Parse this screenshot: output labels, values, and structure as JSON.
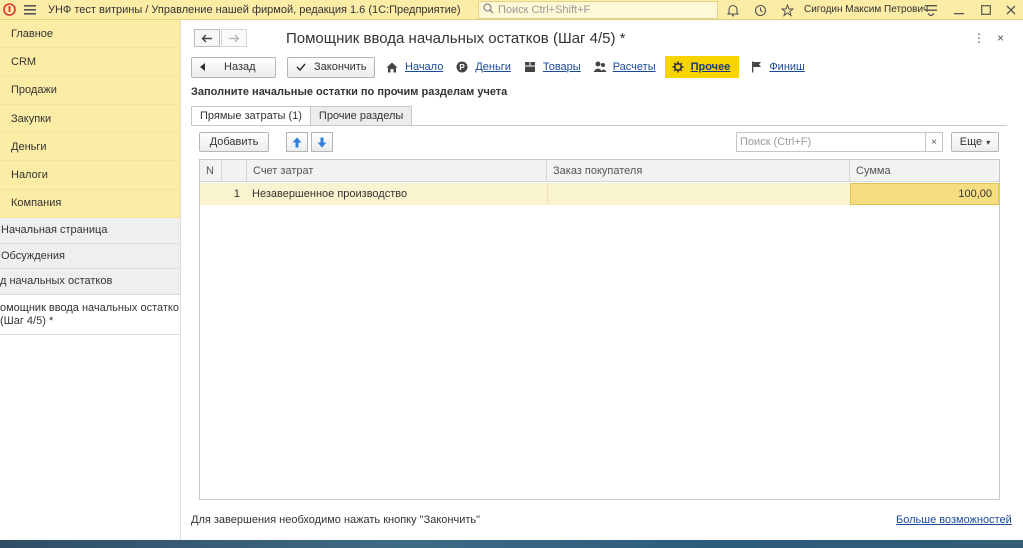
{
  "app": {
    "title": "УНФ тест витрины / Управление нашей фирмой, редакция 1.6  (1С:Предприятие)",
    "search_placeholder": "Поиск Ctrl+Shift+F",
    "user": "Сигодин Максим Петрович"
  },
  "sidebar": {
    "sections": [
      {
        "label": "Главное"
      },
      {
        "label": "CRM"
      },
      {
        "label": "Продажи"
      },
      {
        "label": "Закупки"
      },
      {
        "label": "Деньги"
      },
      {
        "label": "Налоги"
      },
      {
        "label": "Компания"
      }
    ],
    "open_windows": [
      {
        "label": "Начальная страница"
      },
      {
        "label": "Обсуждения"
      },
      {
        "label": "д начальных остатков"
      },
      {
        "label": "омощник ввода начальных остатко (Шаг 4/5) *"
      }
    ]
  },
  "form": {
    "title": "Помощник ввода начальных остатков (Шаг 4/5) *",
    "back_label": "Назад",
    "finish_label": "Закончить",
    "steps": [
      {
        "label": "Начало",
        "icon": "home-icon"
      },
      {
        "label": "Деньги",
        "icon": "money-icon"
      },
      {
        "label": "Товары",
        "icon": "goods-icon"
      },
      {
        "label": "Расчеты",
        "icon": "people-icon"
      },
      {
        "label": "Прочее",
        "icon": "gear-icon",
        "active": true
      },
      {
        "label": "Финиш",
        "icon": "flag-icon"
      }
    ],
    "subtitle": "Заполните начальные остатки по прочим разделам учета",
    "tabs": [
      {
        "label": "Прямые затраты (1)",
        "active": true
      },
      {
        "label": "Прочие разделы",
        "active": false
      }
    ],
    "add_label": "Добавить",
    "table_search_placeholder": "Поиск (Ctrl+F)",
    "clear_symbol": "×",
    "more_label": "Еще",
    "columns": [
      "N",
      "Счет затрат",
      "Заказ покупателя",
      "Сумма"
    ],
    "rows": [
      {
        "n": "1",
        "account": "Незавершенное производство",
        "order": "",
        "sum": "100,00"
      }
    ],
    "footer_text": "Для завершения необходимо нажать кнопку \"Закончить\"",
    "more_features": "Больше возможностей"
  },
  "colors": {
    "accent_yellow": "#fbeca6",
    "active_step": "#f7d300",
    "link": "#1a4a9a"
  }
}
